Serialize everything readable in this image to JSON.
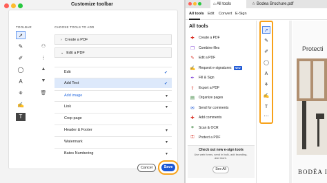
{
  "dialog": {
    "title": "Customize toolbar",
    "toolbar_label": "TOOLBAR",
    "choose_label": "CHOOSE TOOLS TO ADD",
    "rows": [
      {
        "label": "Create a PDF",
        "type": "hdr",
        "arrow": "›"
      },
      {
        "label": "Edit a PDF",
        "type": "hdr",
        "arrow": "⌄"
      },
      {
        "label": "Edit",
        "type": "item",
        "right": "✓"
      },
      {
        "label": "Add Text",
        "type": "hl",
        "right": "✓"
      },
      {
        "label": "Add image",
        "type": "blue",
        "right": "▾"
      },
      {
        "label": "Link",
        "type": "item",
        "right": "▾"
      },
      {
        "label": "Crop page",
        "type": "item",
        "right": ""
      },
      {
        "label": "Header & Footer",
        "type": "item",
        "right": "▾"
      },
      {
        "label": "Watermark",
        "type": "item",
        "right": "▾"
      },
      {
        "label": "Bates Numbering",
        "type": "item",
        "right": "▾"
      }
    ],
    "cancel_label": "Cancel",
    "save_label": "Save"
  },
  "app": {
    "tabs": [
      {
        "label": "All tools"
      },
      {
        "label": "Bodea Brochure.pdf"
      }
    ],
    "nav": [
      {
        "label": "All tools"
      },
      {
        "label": "Edit"
      },
      {
        "label": "Convert"
      },
      {
        "label": "E-Sign"
      }
    ],
    "tools_title": "All tools",
    "tools": [
      {
        "label": "Create a PDF",
        "icon": "create-pdf-icon",
        "glyph": "✚",
        "color": "#d93025"
      },
      {
        "label": "Combine files",
        "icon": "combine-icon",
        "glyph": "❐",
        "color": "#7e3fd6"
      },
      {
        "label": "Edit a PDF",
        "icon": "edit-pdf-icon",
        "glyph": "✎",
        "color": "#d93025"
      },
      {
        "label": "Request e-signatures",
        "icon": "request-sign-icon",
        "glyph": "✍",
        "color": "#7e3fd6",
        "badge": "NEW"
      },
      {
        "label": "Fill & Sign",
        "icon": "fill-sign-icon",
        "glyph": "✒",
        "color": "#7e3fd6"
      },
      {
        "label": "Export a PDF",
        "icon": "export-pdf-icon",
        "glyph": "⇪",
        "color": "#d93025"
      },
      {
        "label": "Organize pages",
        "icon": "organize-icon",
        "glyph": "▤",
        "color": "#2e7d32"
      },
      {
        "label": "Send for comments",
        "icon": "send-comments-icon",
        "glyph": "✉",
        "color": "#1b56d4"
      },
      {
        "label": "Add comments",
        "icon": "add-comments-icon",
        "glyph": "✚",
        "color": "#d93025"
      },
      {
        "label": "Scan & OCR",
        "icon": "scan-ocr-icon",
        "glyph": "⌗",
        "color": "#2e7d32"
      },
      {
        "label": "Protect a PDF",
        "icon": "protect-pdf-icon",
        "glyph": "⚿",
        "color": "#d93025"
      }
    ],
    "esign_title": "Check out new e-sign tools",
    "esign_body": "Use web forms, send in bulk, add branding, and more.",
    "see_all_label": "See All",
    "doc_title": "Protecti",
    "doc_brand": "BODĒA IN"
  }
}
